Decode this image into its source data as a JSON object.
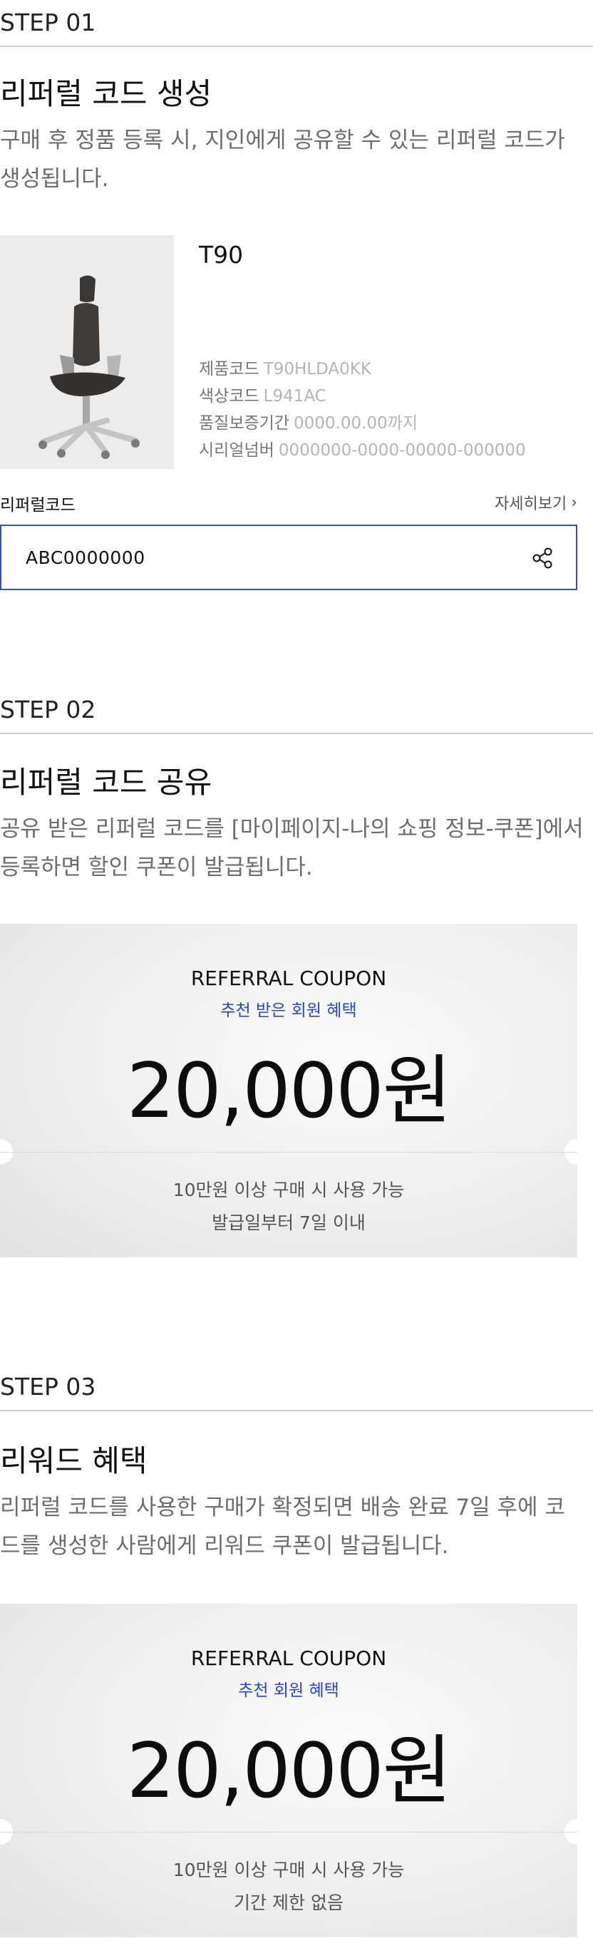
{
  "step1": {
    "label": "STEP 01",
    "title": "리퍼럴 코드 생성",
    "desc": "구매 후 정품 등록 시, 지인에게 공유할 수 있는 리퍼럴 코드가 생성됩니다.",
    "product": {
      "name": "T90",
      "specs": [
        {
          "key": "제품코드",
          "value": "T90HLDA0KK"
        },
        {
          "key": "색상코드",
          "value": "L941AC"
        },
        {
          "key": "품질보증기간",
          "value": "0000.00.00까지"
        },
        {
          "key": "시리얼넘버",
          "value": "0000000-0000-00000-000000"
        }
      ]
    },
    "referral_label": "리퍼럴코드",
    "detail_link": "자세히보기",
    "referral_code": "ABC0000000"
  },
  "step2": {
    "label": "STEP 02",
    "title": "리퍼럴 코드 공유",
    "desc": "공유 받은 리퍼럴 코드를 [마이페이지-나의 쇼핑 정보-쿠폰]에서 등록하면 할인 쿠폰이 발급됩니다.",
    "coupon": {
      "title": "REFERRAL COUPON",
      "subtitle": "추천 받은 회원 혜택",
      "amount": "20,000원",
      "condition1": "10만원 이상 구매 시 사용 가능",
      "condition2": "발급일부터 7일 이내"
    }
  },
  "step3": {
    "label": "STEP 03",
    "title": "리워드 혜택",
    "desc": "리퍼럴 코드를 사용한 구매가 확정되면 배송 완료 7일 후에 코드를 생성한 사람에게 리워드 쿠폰이 발급됩니다.",
    "coupon": {
      "title": "REFERRAL COUPON",
      "subtitle": "추천 회원 혜택",
      "amount": "20,000원",
      "condition1": "10만원 이상 구매 시 사용 가능",
      "condition2": "기간 제한 없음"
    }
  },
  "colors": {
    "accent": "#2b45c4",
    "code_border": "#3853a6",
    "muted_text": "#6d6d6d"
  }
}
